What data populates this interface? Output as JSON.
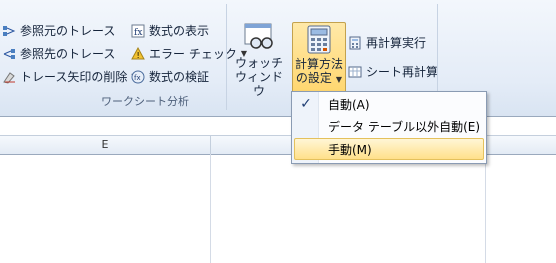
{
  "ribbon": {
    "trace_precedents": "参照元のトレース",
    "trace_dependents": "参照先のトレース",
    "remove_arrows": "トレース矢印の削除",
    "show_formulas": "数式の表示",
    "error_checking": "エラー チェック",
    "evaluate_formula": "数式の検証",
    "watch_window": [
      "ウォッチ",
      "ウィンドウ"
    ],
    "calc_options": [
      "計算方法",
      "の設定"
    ],
    "calc_now": "再計算実行",
    "calc_sheet": "シート再計算",
    "group_label": "ワークシート分析"
  },
  "sheet": {
    "column_e": "E"
  },
  "calc_menu": {
    "items": [
      {
        "label": "自動(A)",
        "checked": true
      },
      {
        "label": "データ テーブル以外自動(E)",
        "checked": false
      },
      {
        "label": "手動(M)",
        "checked": false,
        "highlighted": true
      }
    ]
  },
  "colors": {
    "ribbon_bg": "#e4ecf7",
    "highlight": "#ffe08a",
    "menu_border": "#8a9bb3"
  }
}
